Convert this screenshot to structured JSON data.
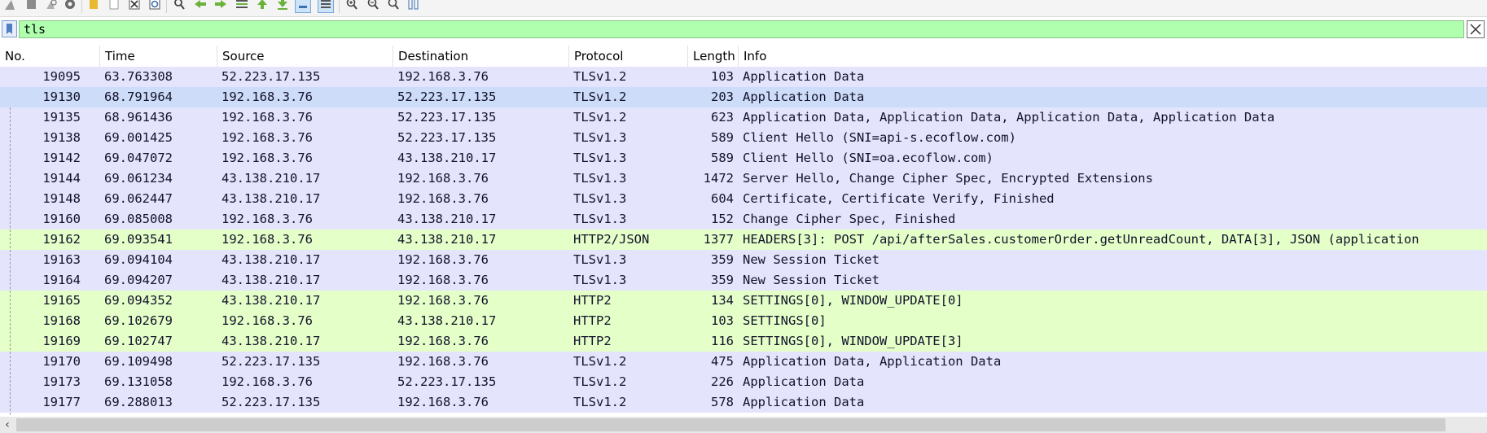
{
  "toolbar": {
    "icons": [
      "shark-fin-icon",
      "stop-capture-icon",
      "restart-capture-icon",
      "capture-options-icon",
      "open-file-icon",
      "save-file-icon",
      "close-file-icon",
      "reload-file-icon",
      "find-packet-icon",
      "go-back-icon",
      "go-forward-icon",
      "go-to-packet-icon",
      "first-packet-icon",
      "last-packet-icon",
      "autoscroll-icon",
      "colorize-icon",
      "zoom-in-icon",
      "zoom-out-icon",
      "normal-size-icon",
      "resize-columns-icon"
    ]
  },
  "filter": {
    "value": "tls"
  },
  "columns": [
    "No.",
    "Time",
    "Source",
    "Destination",
    "Protocol",
    "Length",
    "Info"
  ],
  "colors": {
    "tls_row": "#e4e4fc",
    "http2_row": "#e4ffc8",
    "selected_row": "#cddcf8",
    "filter_valid": "#afffaf"
  },
  "rows": [
    {
      "no": "19095",
      "time": "63.763308",
      "src": "52.223.17.135",
      "dst": "192.168.3.76",
      "proto": "TLSv1.2",
      "len": "103",
      "info": "Application Data",
      "kind": "tls"
    },
    {
      "no": "19130",
      "time": "68.791964",
      "src": "192.168.3.76",
      "dst": "52.223.17.135",
      "proto": "TLSv1.2",
      "len": "203",
      "info": "Application Data",
      "kind": "selected"
    },
    {
      "no": "19135",
      "time": "68.961436",
      "src": "192.168.3.76",
      "dst": "52.223.17.135",
      "proto": "TLSv1.2",
      "len": "623",
      "info": "Application Data, Application Data, Application Data, Application Data",
      "kind": "tls"
    },
    {
      "no": "19138",
      "time": "69.001425",
      "src": "192.168.3.76",
      "dst": "52.223.17.135",
      "proto": "TLSv1.3",
      "len": "589",
      "info": "Client Hello (SNI=api-s.ecoflow.com)",
      "kind": "tls"
    },
    {
      "no": "19142",
      "time": "69.047072",
      "src": "192.168.3.76",
      "dst": "43.138.210.17",
      "proto": "TLSv1.3",
      "len": "589",
      "info": "Client Hello (SNI=oa.ecoflow.com)",
      "kind": "tls"
    },
    {
      "no": "19144",
      "time": "69.061234",
      "src": "43.138.210.17",
      "dst": "192.168.3.76",
      "proto": "TLSv1.3",
      "len": "1472",
      "info": "Server Hello, Change Cipher Spec, Encrypted Extensions",
      "kind": "tls"
    },
    {
      "no": "19148",
      "time": "69.062447",
      "src": "43.138.210.17",
      "dst": "192.168.3.76",
      "proto": "TLSv1.3",
      "len": "604",
      "info": "Certificate, Certificate Verify, Finished",
      "kind": "tls"
    },
    {
      "no": "19160",
      "time": "69.085008",
      "src": "192.168.3.76",
      "dst": "43.138.210.17",
      "proto": "TLSv1.3",
      "len": "152",
      "info": "Change Cipher Spec, Finished",
      "kind": "tls"
    },
    {
      "no": "19162",
      "time": "69.093541",
      "src": "192.168.3.76",
      "dst": "43.138.210.17",
      "proto": "HTTP2/JSON",
      "len": "1377",
      "info": "HEADERS[3]: POST /api/afterSales.customerOrder.getUnreadCount, DATA[3], JSON (application",
      "kind": "http2"
    },
    {
      "no": "19163",
      "time": "69.094104",
      "src": "43.138.210.17",
      "dst": "192.168.3.76",
      "proto": "TLSv1.3",
      "len": "359",
      "info": "New Session Ticket",
      "kind": "tls"
    },
    {
      "no": "19164",
      "time": "69.094207",
      "src": "43.138.210.17",
      "dst": "192.168.3.76",
      "proto": "TLSv1.3",
      "len": "359",
      "info": "New Session Ticket",
      "kind": "tls"
    },
    {
      "no": "19165",
      "time": "69.094352",
      "src": "43.138.210.17",
      "dst": "192.168.3.76",
      "proto": "HTTP2",
      "len": "134",
      "info": "SETTINGS[0], WINDOW_UPDATE[0]",
      "kind": "http2"
    },
    {
      "no": "19168",
      "time": "69.102679",
      "src": "192.168.3.76",
      "dst": "43.138.210.17",
      "proto": "HTTP2",
      "len": "103",
      "info": "SETTINGS[0]",
      "kind": "http2"
    },
    {
      "no": "19169",
      "time": "69.102747",
      "src": "43.138.210.17",
      "dst": "192.168.3.76",
      "proto": "HTTP2",
      "len": "116",
      "info": "SETTINGS[0], WINDOW_UPDATE[3]",
      "kind": "http2"
    },
    {
      "no": "19170",
      "time": "69.109498",
      "src": "52.223.17.135",
      "dst": "192.168.3.76",
      "proto": "TLSv1.2",
      "len": "475",
      "info": "Application Data, Application Data",
      "kind": "tls"
    },
    {
      "no": "19173",
      "time": "69.131058",
      "src": "192.168.3.76",
      "dst": "52.223.17.135",
      "proto": "TLSv1.2",
      "len": "226",
      "info": "Application Data",
      "kind": "tls"
    },
    {
      "no": "19177",
      "time": "69.288013",
      "src": "52.223.17.135",
      "dst": "192.168.3.76",
      "proto": "TLSv1.2",
      "len": "578",
      "info": "Application Data",
      "kind": "tls"
    }
  ]
}
